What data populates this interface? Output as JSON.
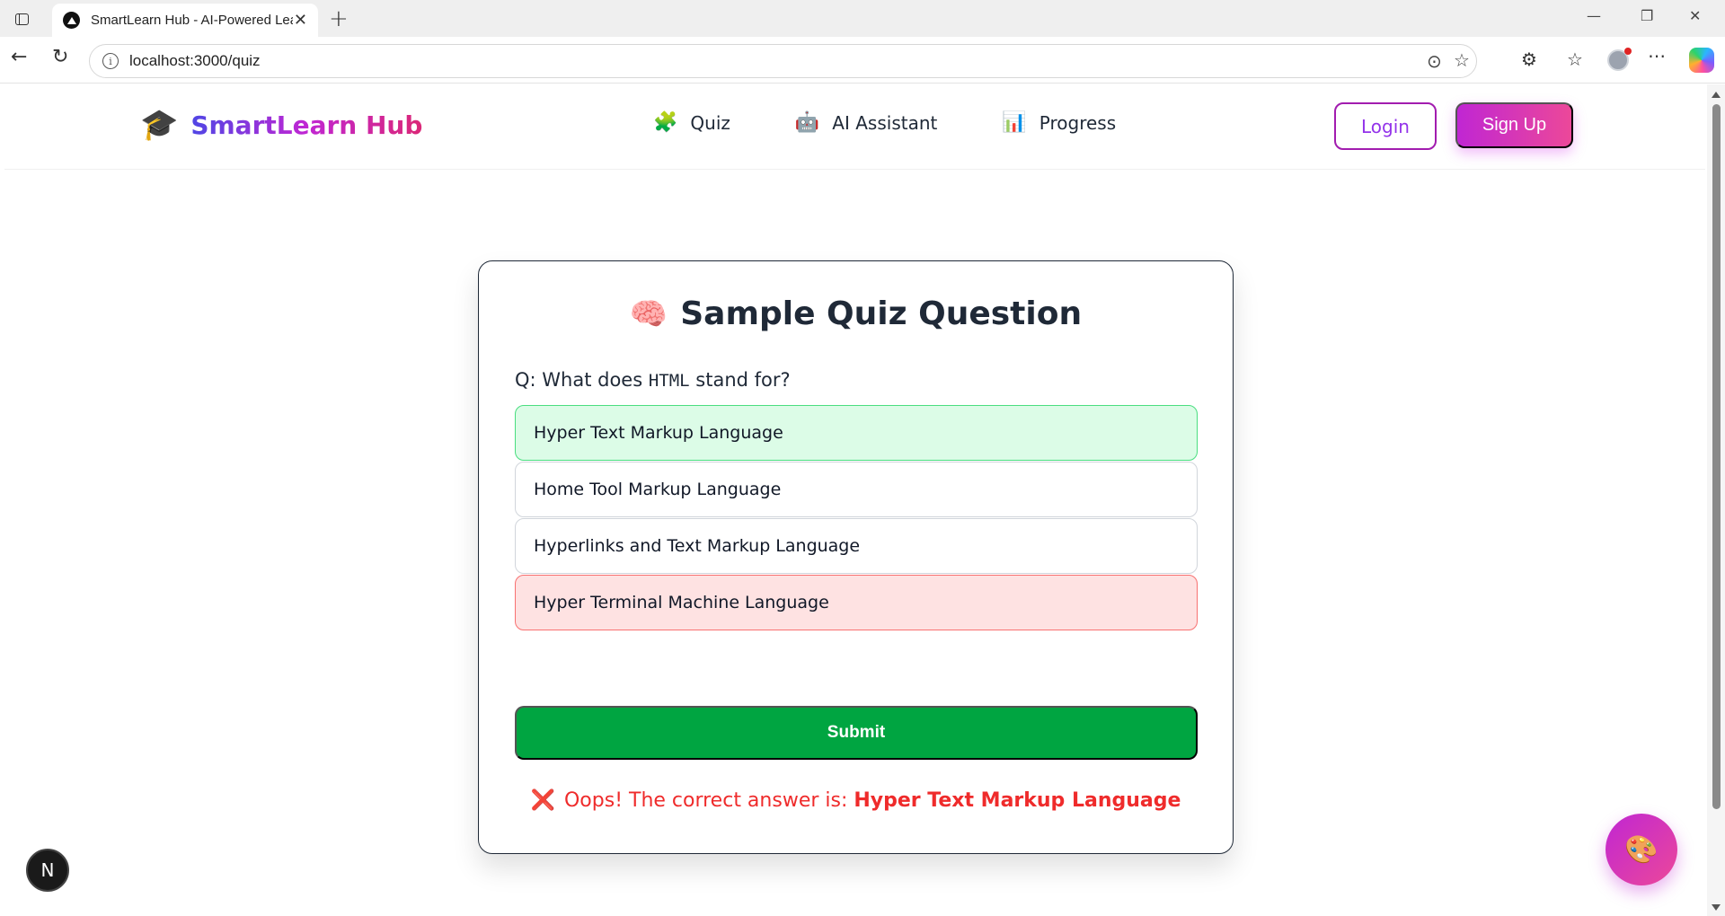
{
  "browser": {
    "tab_title": "SmartLearn Hub - AI-Powered Learning",
    "tab_close": "✕",
    "new_tab": "+",
    "url": "localhost:3000/quiz",
    "window_controls": {
      "minimize": "—",
      "restore": "❐",
      "close": "✕"
    }
  },
  "header": {
    "brand_icon": "🎓",
    "brand_name": "SmartLearn Hub",
    "nav": [
      {
        "icon": "🧩",
        "label": "Quiz"
      },
      {
        "icon": "🤖",
        "label": "AI Assistant"
      },
      {
        "icon": "📊",
        "label": "Progress"
      }
    ],
    "login_label": "Login",
    "signup_label": "Sign Up"
  },
  "quiz": {
    "title_icon": "🧠",
    "title": "Sample Quiz Question",
    "question_prefix": "Q: What does ",
    "question_code": "HTML",
    "question_suffix": " stand for?",
    "options": [
      {
        "label": "Hyper Text Markup Language",
        "state": "correct"
      },
      {
        "label": "Home Tool Markup Language",
        "state": "neutral"
      },
      {
        "label": "Hyperlinks and Text Markup Language",
        "state": "neutral"
      },
      {
        "label": "Hyper Terminal Machine Language",
        "state": "wrong"
      }
    ],
    "submit_label": "Submit",
    "feedback_icon": "❌",
    "feedback_text": "Oops! The correct answer is: ",
    "feedback_answer": "Hyper Text Markup Language"
  },
  "floating": {
    "dev_badge": "N",
    "palette_icon": "🎨"
  },
  "colors": {
    "brand_gradient_start": "#4f46e5",
    "brand_gradient_end": "#db2777",
    "submit": "#00a541",
    "correct_bg": "#dcfce7",
    "wrong_bg": "#fee2e2",
    "feedback": "#ef2b2b"
  }
}
